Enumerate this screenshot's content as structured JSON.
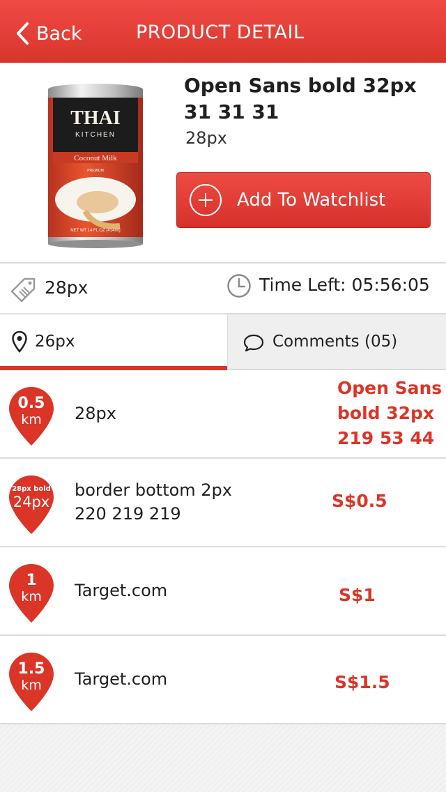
{
  "header": {
    "back_label": "Back",
    "title": "PRODUCT DETAIL"
  },
  "product": {
    "image_icon": "product-can-image",
    "can": {
      "brand_line1": "THAI",
      "brand_line2": "KITCHEN",
      "variant": "Coconut Milk",
      "grade": "PREMIUM",
      "net_wt": "NET WT 14 FL OZ (414ml)"
    },
    "name": "Open Sans bold 32px 31 31 31",
    "subtitle": "28px",
    "watch_button": "Add To Watchlist"
  },
  "info": {
    "left_text": "28px",
    "right_text": "Time Left: 05:56:05"
  },
  "tabs": {
    "location_label": "26px",
    "comments_label": "Comments (05)"
  },
  "stores": [
    {
      "distance": "0.5",
      "unit": "km",
      "name": "28px",
      "price": "Open Sans bold 32px 219 53 44"
    },
    {
      "distance_note": "28px bold",
      "distance": "24px",
      "name": "border bottom 2px 220 219 219",
      "price": "S$0.5"
    },
    {
      "distance": "1",
      "unit": "km",
      "name": "Target.com",
      "price": "S$1"
    },
    {
      "distance": "1.5",
      "unit": "km",
      "name": "Target.com",
      "price": "S$1.5"
    }
  ],
  "colors": {
    "accent": "#db3528",
    "header": "#e7403a",
    "text": "#1f1f1f",
    "border": "#dcdbdb"
  }
}
